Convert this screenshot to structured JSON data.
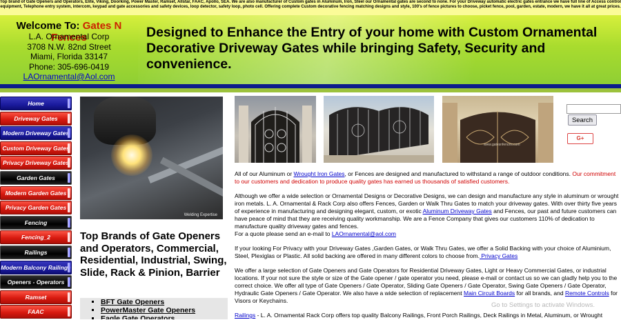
{
  "top_banner": {
    "text": "Top brand of Gate Openers and Operators, Elite, Viking, Doorking, Power Master, Ramset, Allstar, FAAC, Apollo, SEA. We are also manufacturer of Custom gates in Aluminum, Iron, Steel our Ornamental gates are second to none. For your Driveway automatic electric gates entrance we have full line of Access control equipment, Telephone entry system, intercom, keypad and gate accessories and safety devices, loop detector, safety loop, photo cell. Offering complete Custom decorative fencing matching designs and style, 100's of fence pictures to choose, picket fence, pool, garden, estate, modern, we have it all at great prices."
  },
  "header": {
    "welcome_prefix": "Welcome To: ",
    "brand": "Gates N Fences",
    "company": "L.A. Ornamental Corp",
    "street": "3708 N.W. 82nd Street",
    "city": "Miami, Florida 33147",
    "phone": "Phone: 305-696-0419",
    "email": "LAOrnamental@Aol.com",
    "headline": "Designed to Enhance the Entry of your home with Custom Ornamental Decorative Driveway Gates while bringing Safety, Security and convenience."
  },
  "sidebar": {
    "items": [
      {
        "label": "Home",
        "style": "blue"
      },
      {
        "label": "Driveway Gates",
        "style": "red"
      },
      {
        "label": "Modern Driveway Gates",
        "style": "blue"
      },
      {
        "label": "Custom Driveway Gates",
        "style": "red"
      },
      {
        "label": "Privacy Driveway Gates",
        "style": "red"
      },
      {
        "label": "Garden Gates",
        "style": "black"
      },
      {
        "label": "Modern Garden Gates",
        "style": "red"
      },
      {
        "label": "Privacy Garden Gates",
        "style": "red"
      },
      {
        "label": "Fencing",
        "style": "black"
      },
      {
        "label": "Fencing_2",
        "style": "red"
      },
      {
        "label": "Railings",
        "style": "black"
      },
      {
        "label": "Modern Balcony Railings",
        "style": "blue"
      },
      {
        "label": "Openers - Operators",
        "style": "black"
      },
      {
        "label": "Ramset",
        "style": "red"
      },
      {
        "label": "FAAC",
        "style": "red"
      }
    ]
  },
  "welder_image": {
    "caption": "Welding Expertise"
  },
  "gallery": {
    "watermark": "www.gatesnfences.com"
  },
  "search": {
    "placeholder": "",
    "button_label": "Search",
    "gplus_label": "G+"
  },
  "intro": {
    "p1_a": "All of our Aluminum or ",
    "p1_link": "Wrought Iron Gates",
    "p1_b": ", or Fences are designed and manufactured to withstand a range of outdoor conditions. ",
    "p1_red": "Our commitment to our customers and dedication to produce quality gates has earned us thousands of satisfied customers.",
    "p2_a": "Although we offer a wide selection or Ornamental Designs or Decorative Designs, we can design and manufacture any style in aluminum or wrought iron metals. L. A. Ornamental & Rack Corp also offers Fences, Garden or Walk Thru Gates to match your driveway  gates. With over thirty five years of experience in manufacturing and designing elegant, custom, or exotic ",
    "p2_link": "Aluminum Driveway Gates",
    "p2_b": " and Fences, our past and future customers can have peace of mind that they are receiving quality workmanship.  We are a Fence Company that gives our customers 110% of dedication to manufacture quality driveway gates and fences.",
    "p2_c": "For a quote please send an e-mail to ",
    "p2_email": "LAOrnamental@aol.com",
    "p3_a": "If your looking For Privacy with your Driveway Gates ,Garden Gates, or Walk Thru Gates, we offer a Solid Backing with your choice of Aluminium, Steel, Plexiglas or Plastic.  All solid backing are offered in many different colors to choose from.",
    "p3_link": " Privacy Gates",
    "p4_a": "We offer a large selection of  Gate Openers and Gate Operators for Residential Driveway Gates, Light or Heavy Commercial Gates, or industrial locations. If your not sure the style or size of the Gate opener / gate operator  you need, please e-mail or contact us so we can gladly help you to the correct choice. We offer all type of Gate Openers / Gate Operator, Sliding Gate Openers / Gate Operator, Swing Gate Openers / Gate Operator, Hydraulic Gate Openers / Gate Operator. We also have a wide selection of replacement ",
    "p4_link1": "Main Circuit Boards",
    "p4_b": " for all brands, and ",
    "p4_link2": "Remote Controls",
    "p4_c": "  for Visors or Keychains.",
    "p5_link": "Railings",
    "p5_a": " - L. A. Ornamental Rack Corp offers top quality Balcony Railings, Front Porch Railings, Deck Railings in Metal, Aluminum, or Wrought"
  },
  "brands": {
    "title": "Top Brands of Gate Openers and Operators, Commercial, Residential, Industrial, Swing, Slide, Rack & Pinion, Barrier",
    "list": [
      "BFT Gate Openers",
      "PowerMaster Gate Openers",
      "Eagle Gate Operators"
    ]
  },
  "os_watermark": "Go to Settings to activate Windows."
}
